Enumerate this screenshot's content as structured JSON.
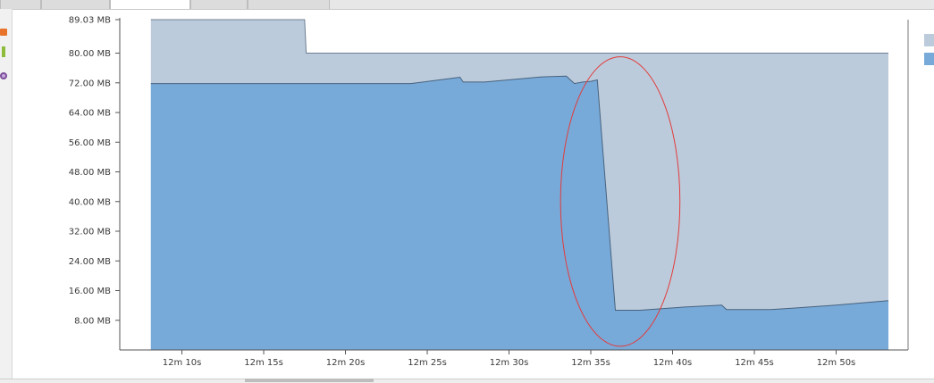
{
  "tabs": [
    "",
    "",
    "",
    "",
    ""
  ],
  "legend": {
    "heap_size_color": "#bccbdb",
    "used_heap_color": "#78aad9"
  },
  "toolbar_icons": [
    "record-icon",
    "gc-icon",
    "heap-dump-icon"
  ],
  "chart_data": {
    "type": "area",
    "title": "",
    "xlabel": "",
    "ylabel": "",
    "y_unit": "MB",
    "ylim": [
      0,
      89.03
    ],
    "xlim": [
      6.2,
      54.4
    ],
    "y_ticks": [
      {
        "value": 89.03,
        "label": "89.03 MB"
      },
      {
        "value": 80,
        "label": "80.00 MB"
      },
      {
        "value": 72,
        "label": "72.00 MB"
      },
      {
        "value": 64,
        "label": "64.00 MB"
      },
      {
        "value": 56,
        "label": "56.00 MB"
      },
      {
        "value": 48,
        "label": "48.00 MB"
      },
      {
        "value": 40,
        "label": "40.00 MB"
      },
      {
        "value": 32,
        "label": "32.00 MB"
      },
      {
        "value": 24,
        "label": "24.00 MB"
      },
      {
        "value": 16,
        "label": "16.00 MB"
      },
      {
        "value": 8,
        "label": "8.00 MB"
      }
    ],
    "x_ticks": [
      {
        "value": 10,
        "label": "12m 10s"
      },
      {
        "value": 15,
        "label": "12m 15s"
      },
      {
        "value": 20,
        "label": "12m 20s"
      },
      {
        "value": 25,
        "label": "12m 25s"
      },
      {
        "value": 30,
        "label": "12m 30s"
      },
      {
        "value": 35,
        "label": "12m 35s"
      },
      {
        "value": 40,
        "label": "12m 40s"
      },
      {
        "value": 45,
        "label": "12m 45s"
      },
      {
        "value": 50,
        "label": "12m 50s"
      }
    ],
    "grid": false,
    "legend_position": "right",
    "series": [
      {
        "color": "#bccbdb",
        "points": [
          [
            8.1,
            89.03
          ],
          [
            17.5,
            89.03
          ],
          [
            17.6,
            80
          ],
          [
            53.2,
            80
          ]
        ]
      },
      {
        "color": "#78aad9",
        "points": [
          [
            8.1,
            71.8
          ],
          [
            20,
            71.8
          ],
          [
            24,
            71.8
          ],
          [
            27,
            73.5
          ],
          [
            27.2,
            72.2
          ],
          [
            28.5,
            72.2
          ],
          [
            32,
            73.6
          ],
          [
            33.5,
            73.8
          ],
          [
            34,
            71.8
          ],
          [
            34.5,
            72.2
          ],
          [
            35,
            72.4
          ],
          [
            35.4,
            72.8
          ],
          [
            36.5,
            10.7
          ],
          [
            38,
            10.7
          ],
          [
            40.5,
            11.5
          ],
          [
            43,
            12.1
          ],
          [
            43.3,
            10.9
          ],
          [
            44.5,
            10.9
          ],
          [
            46,
            10.9
          ],
          [
            47.5,
            11.3
          ],
          [
            50,
            12.1
          ],
          [
            53.2,
            13.3
          ]
        ]
      }
    ],
    "annotations": [
      {
        "type": "ellipse",
        "color": "#e23b3b",
        "center": [
          36.8,
          40
        ],
        "radius": [
          3.65,
          39
        ]
      }
    ]
  }
}
